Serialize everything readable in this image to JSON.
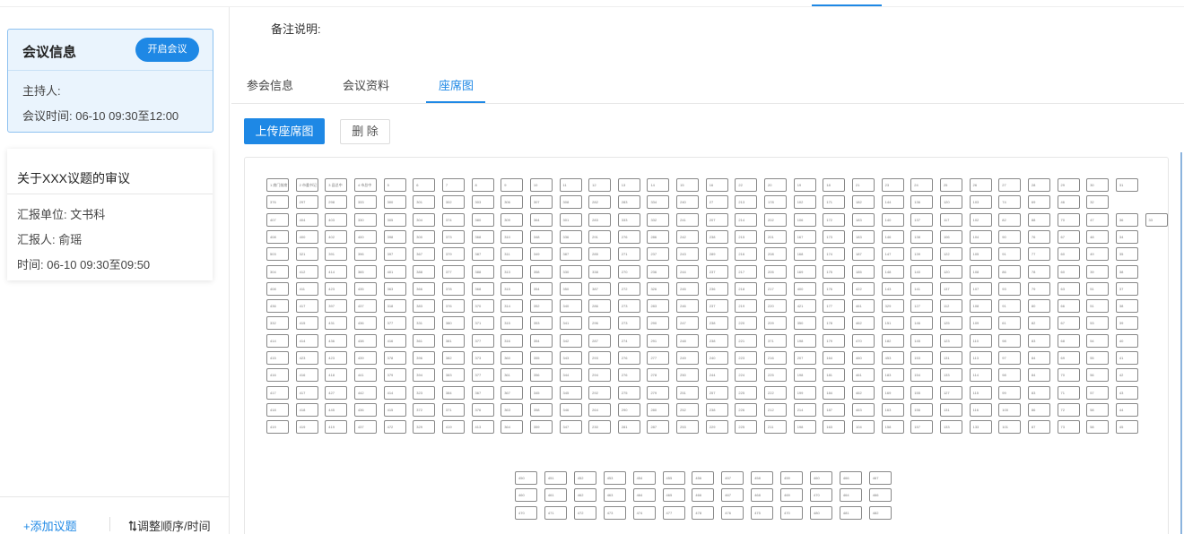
{
  "left_panel": {
    "meeting": {
      "title": "会议信息",
      "start_button": "开启会议",
      "host": "主持人:",
      "time": "会议时间: 06-10 09:30至12:00"
    },
    "topic": {
      "title": "关于XXX议题的审议",
      "unit": "汇报单位: 文书科",
      "reporter": "汇报人:  俞瑶",
      "time": "时间:  06-10 09:30至09:50"
    },
    "add_topic": "+添加议题",
    "adjust": "调整顺序/时间"
  },
  "main": {
    "remark_label": "备注说明:",
    "tabs": [
      {
        "label": "参会信息",
        "active": false
      },
      {
        "label": "会议资料",
        "active": false
      },
      {
        "label": "座席图",
        "active": true
      }
    ],
    "upload_button": "上传座席图",
    "delete_button": "删 除"
  },
  "colors": {
    "accent": "#1e88e5",
    "card_bg": "#eaf4fd",
    "card_border": "#8ec2f0"
  },
  "seat_chart": {
    "main_grid": [
      [
        "1 席门前席",
        "2 市委书记",
        "3 县总中",
        "4 市总中",
        "5",
        "6",
        "7",
        "8",
        "9",
        "10",
        "11",
        "12",
        "13",
        "14",
        "15",
        "16",
        "22",
        "20",
        "19",
        "18",
        "21",
        "23",
        "24",
        "25",
        "26",
        "27",
        "28",
        "29",
        "30",
        "31"
      ],
      [
        "376",
        "297",
        "298",
        "333",
        "300",
        "301",
        "302",
        "303",
        "306",
        "307",
        "308",
        "282",
        "283",
        "334",
        "240",
        "27",
        "213",
        "178",
        "102",
        "171",
        "182",
        "144",
        "136",
        "120",
        "103",
        "74",
        "69",
        "46",
        "32"
      ],
      [
        "407",
        "404",
        "403",
        "330",
        "305",
        "304",
        "374",
        "380",
        "309",
        "364",
        "301",
        "283",
        "333",
        "332",
        "241",
        "207",
        "214",
        "202",
        "106",
        "172",
        "183",
        "140",
        "137",
        "117",
        "102",
        "82",
        "88",
        "70",
        "47",
        "36",
        "33"
      ],
      [
        "408",
        "400",
        "402",
        "400",
        "398",
        "300",
        "373",
        "368",
        "310",
        "348",
        "336",
        "291",
        "276",
        "286",
        "242",
        "238",
        "215",
        "201",
        "167",
        "173",
        "183",
        "146",
        "138",
        "106",
        "104",
        "90",
        "76",
        "67",
        "48",
        "34"
      ],
      [
        "503",
        "321",
        "391",
        "396",
        "397",
        "367",
        "379",
        "387",
        "311",
        "349",
        "387",
        "285",
        "271",
        "237",
        "243",
        "289",
        "216",
        "208",
        "168",
        "174",
        "187",
        "147",
        "139",
        "122",
        "105",
        "91",
        "77",
        "60",
        "49",
        "35"
      ],
      [
        "304",
        "412",
        "414",
        "365",
        "401",
        "388",
        "377",
        "388",
        "313",
        "358",
        "330",
        "338",
        "270",
        "236",
        "244",
        "237",
        "217",
        "205",
        "169",
        "175",
        "185",
        "148",
        "140",
        "120",
        "108",
        "86",
        "78",
        "60",
        "39",
        "38"
      ],
      [
        "408",
        "411",
        "423",
        "435",
        "363",
        "366",
        "378",
        "368",
        "315",
        "354",
        "350",
        "387",
        "272",
        "326",
        "245",
        "236",
        "218",
        "217",
        "400",
        "176",
        "422",
        "143",
        "141",
        "137",
        "107",
        "93",
        "79",
        "63",
        "51",
        "37"
      ],
      [
        "436",
        "417",
        "397",
        "437",
        "318",
        "383",
        "376",
        "370",
        "314",
        "352",
        "340",
        "286",
        "273",
        "283",
        "246",
        "237",
        "219",
        "220",
        "421",
        "177",
        "461",
        "329",
        "127",
        "112",
        "108",
        "91",
        "80",
        "66",
        "51",
        "38"
      ],
      [
        "332",
        "415",
        "431",
        "436",
        "377",
        "331",
        "380",
        "371",
        "315",
        "353",
        "341",
        "296",
        "273",
        "290",
        "247",
        "238",
        "220",
        "209",
        "350",
        "178",
        "462",
        "151",
        "146",
        "125",
        "109",
        "61",
        "82",
        "67",
        "53",
        "39"
      ],
      [
        "414",
        "414",
        "436",
        "438",
        "416",
        "361",
        "381",
        "377",
        "316",
        "354",
        "342",
        "287",
        "274",
        "291",
        "248",
        "238",
        "221",
        "371",
        "198",
        "179",
        "470",
        "182",
        "145",
        "123",
        "110",
        "98",
        "83",
        "68",
        "54",
        "40"
      ],
      [
        "415",
        "423",
        "423",
        "439",
        "378",
        "396",
        "382",
        "373",
        "360",
        "355",
        "343",
        "293",
        "276",
        "277",
        "249",
        "240",
        "223",
        "216",
        "207",
        "164",
        "460",
        "453",
        "153",
        "131",
        "113",
        "97",
        "84",
        "69",
        "55",
        "41"
      ],
      [
        "416",
        "416",
        "418",
        "441",
        "379",
        "394",
        "383",
        "377",
        "361",
        "356",
        "344",
        "294",
        "276",
        "278",
        "250",
        "244",
        "224",
        "225",
        "198",
        "181",
        "461",
        "183",
        "154",
        "133",
        "114",
        "98",
        "84",
        "70",
        "56",
        "42"
      ],
      [
        "417",
        "417",
        "427",
        "442",
        "414",
        "323",
        "384",
        "367",
        "367",
        "345",
        "345",
        "292",
        "275",
        "279",
        "251",
        "257",
        "225",
        "222",
        "199",
        "184",
        "462",
        "169",
        "155",
        "127",
        "115",
        "99",
        "83",
        "71",
        "57",
        "43"
      ],
      [
        "418",
        "418",
        "445",
        "436",
        "415",
        "372",
        "371",
        "376",
        "363",
        "358",
        "346",
        "264",
        "290",
        "280",
        "252",
        "238",
        "226",
        "212",
        "214",
        "187",
        "463",
        "163",
        "156",
        "131",
        "116",
        "100",
        "86",
        "72",
        "58",
        "44"
      ],
      [
        "419",
        "419",
        "419",
        "437",
        "472",
        "329",
        "419",
        "413",
        "364",
        "359",
        "347",
        "230",
        "281",
        "287",
        "253",
        "229",
        "225",
        "211",
        "198",
        "163",
        "104",
        "158",
        "157",
        "133",
        "133",
        "101",
        "87",
        "73",
        "58",
        "45"
      ]
    ],
    "stage_grid": [
      [
        "450",
        "451",
        "452",
        "453",
        "454",
        "455",
        "456",
        "457",
        "458",
        "459",
        "460",
        "466",
        "467"
      ],
      [
        "460",
        "461",
        "462",
        "463",
        "464",
        "465",
        "466",
        "467",
        "468",
        "469",
        "470",
        "464",
        "466"
      ],
      [
        "470",
        "471",
        "472",
        "473",
        "474",
        "477",
        "478",
        "476",
        "475",
        "470",
        "480",
        "481",
        "482"
      ]
    ]
  }
}
